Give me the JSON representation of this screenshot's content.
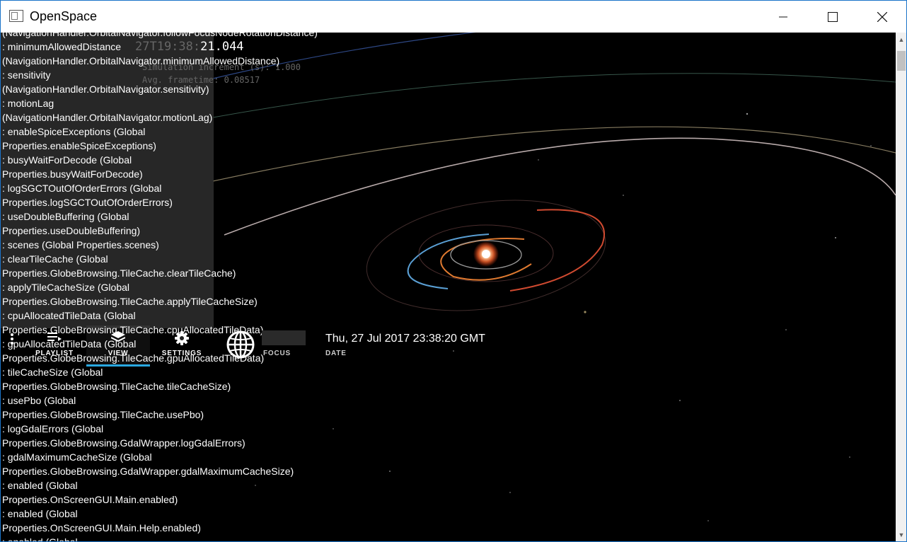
{
  "window": {
    "title": "OpenSpace"
  },
  "hud": {
    "time_dim": "27T19:38:",
    "time_bright": "21.044",
    "line1": "Simulation increment (s): 1.000",
    "line2": "Avg. frametime: 0.08517"
  },
  "log_lines": [
    "(NavigationHandler.OrbitalNavigator.followFocusNodeRotationDistance)",
    ": minimumAllowedDistance",
    "(NavigationHandler.OrbitalNavigator.minimumAllowedDistance)",
    ": sensitivity",
    "(NavigationHandler.OrbitalNavigator.sensitivity)",
    ": motionLag",
    "(NavigationHandler.OrbitalNavigator.motionLag)",
    ": enableSpiceExceptions (Global",
    "Properties.enableSpiceExceptions)",
    ": busyWaitForDecode (Global",
    "Properties.busyWaitForDecode)",
    ": logSGCTOutOfOrderErrors (Global",
    "Properties.logSGCTOutOfOrderErrors)",
    ": useDoubleBuffering (Global",
    "Properties.useDoubleBuffering)",
    ": scenes (Global Properties.scenes)",
    ": clearTileCache (Global",
    "Properties.GlobeBrowsing.TileCache.clearTileCache)",
    ": applyTileCacheSize (Global",
    "Properties.GlobeBrowsing.TileCache.applyTileCacheSize)",
    ": cpuAllocatedTileData (Global",
    "Properties.GlobeBrowsing.TileCache.cpuAllocatedTileData)",
    ": gpuAllocatedTileData (Global",
    "Properties.GlobeBrowsing.TileCache.gpuAllocatedTileData)",
    ": tileCacheSize (Global",
    "Properties.GlobeBrowsing.TileCache.tileCacheSize)",
    ": usePbo (Global",
    "Properties.GlobeBrowsing.TileCache.usePbo)",
    ": logGdalErrors (Global",
    "Properties.GlobeBrowsing.GdalWrapper.logGdalErrors)",
    ": gdalMaximumCacheSize (Global",
    "Properties.GlobeBrowsing.GdalWrapper.gdalMaximumCacheSize)",
    ": enabled (Global",
    "Properties.OnScreenGUI.Main.enabled)",
    ": enabled (Global",
    "Properties.OnScreenGUI.Main.Help.enabled)",
    ": enabled (Global"
  ],
  "menu": {
    "playlist": "PLAYLIST",
    "view": "VIEW",
    "settings": "SETTINGS",
    "focus_label": "FOCUS",
    "date_value": "Thu, 27 Jul 2017 23:38:20 GMT",
    "date_label": "DATE"
  },
  "colors": {
    "accent": "#2aa8e0",
    "sun": "#ff7a3a",
    "orbit_mercury": "#888888",
    "orbit_venus": "#e07a30",
    "orbit_earth": "#5a9fd4",
    "orbit_mars": "#d04a30"
  }
}
